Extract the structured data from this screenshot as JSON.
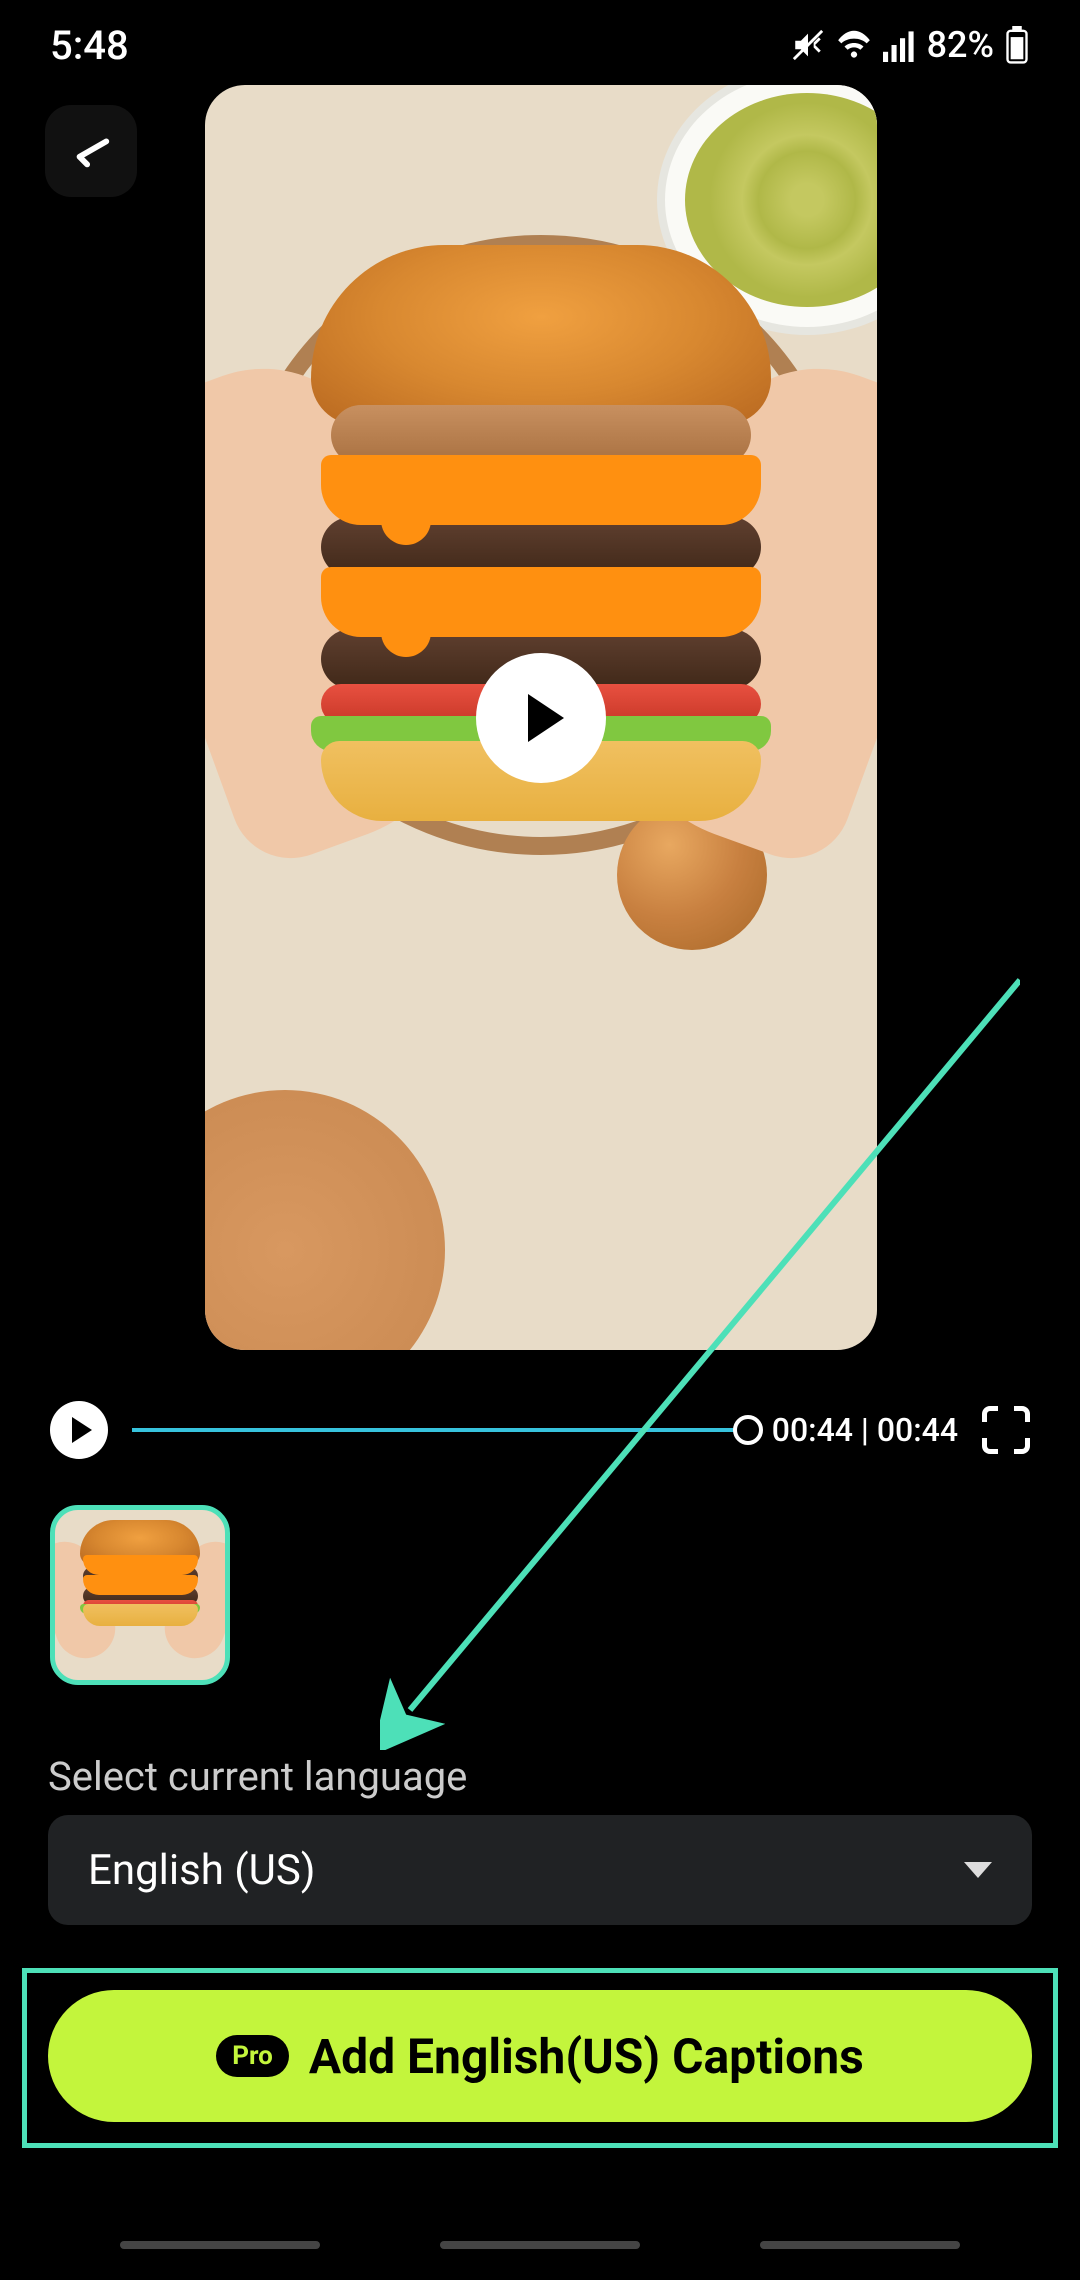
{
  "status": {
    "time": "5:48",
    "battery": "82%"
  },
  "player": {
    "current_time": "00:44",
    "duration": "00:44",
    "time_display": "00:44 | 00:44"
  },
  "language": {
    "label": "Select current language",
    "selected": "English (US)"
  },
  "action": {
    "pro_badge": "Pro",
    "button_text": "Add English(US) Captions"
  }
}
